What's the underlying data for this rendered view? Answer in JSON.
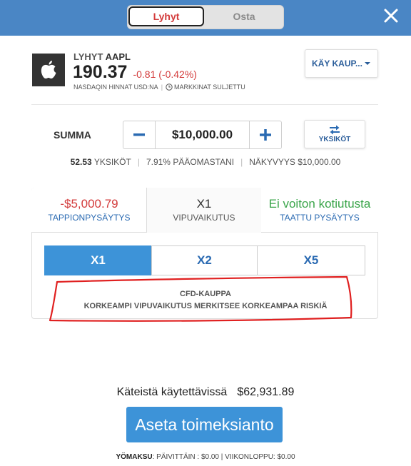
{
  "header": {
    "mode_toggle": {
      "short_label": "Lyhyt",
      "buy_label": "Osta",
      "selected": "Lyhyt"
    },
    "close_icon": "close-icon"
  },
  "asset": {
    "direction": "LYHYT",
    "symbol": "AAPL",
    "price": "190.37",
    "change": "-0.81 (-0.42%)",
    "exchange_info": "NASDAQIN HINNAT USD:NA",
    "market_status": "MARKKINAT SULJETTU",
    "logo_icon": "apple-logo-icon"
  },
  "trade_button": {
    "label": "KÄY KAUP...",
    "icon": "caret-down-icon"
  },
  "amount": {
    "label": "SUMMA",
    "value": "$10,000.00",
    "units_button_label": "YKSIKÖT",
    "units_icon": "swap-arrows-icon"
  },
  "summary": {
    "units_value": "52.53",
    "units_label": "YKSIKÖT",
    "equity": "7.91% PÄÄOMASTANI",
    "exposure": "NÄKYVYYS $10,000.00"
  },
  "tabs": {
    "stop_loss": {
      "value": "-$5,000.79",
      "label": "TAPPIONPYSÄYTYS"
    },
    "leverage": {
      "value": "X1",
      "label": "VIPUVAIKUTUS"
    },
    "take_profit": {
      "value": "Ei voiton kotiutusta",
      "label": "TAATTU PYSÄYTYS"
    }
  },
  "leverage_options": [
    "X1",
    "X2",
    "X5"
  ],
  "leverage_selected": "X1",
  "cfd_notice": {
    "line1": "CFD-KAUPPA",
    "line2": "KORKEAMPI VIPUVAIKUTUS MERKITSEE KORKEAMPAA RISKIÄ"
  },
  "cash": {
    "label": "Käteistä käytettävissä",
    "value": "$62,931.89"
  },
  "submit_label": "Aseta toimeksianto",
  "fees": {
    "label": "YÖMAKSU",
    "daily": "PÄIVITTÄIN : $0.00",
    "weekend": "VIIKONLOPPU: $0.00"
  },
  "colors": {
    "header_bg": "#4a86c5",
    "accent_blue": "#3d93d8",
    "negative_red": "#d33b3b",
    "positive_green": "#3aa54a",
    "annotation_red": "#e02020"
  }
}
